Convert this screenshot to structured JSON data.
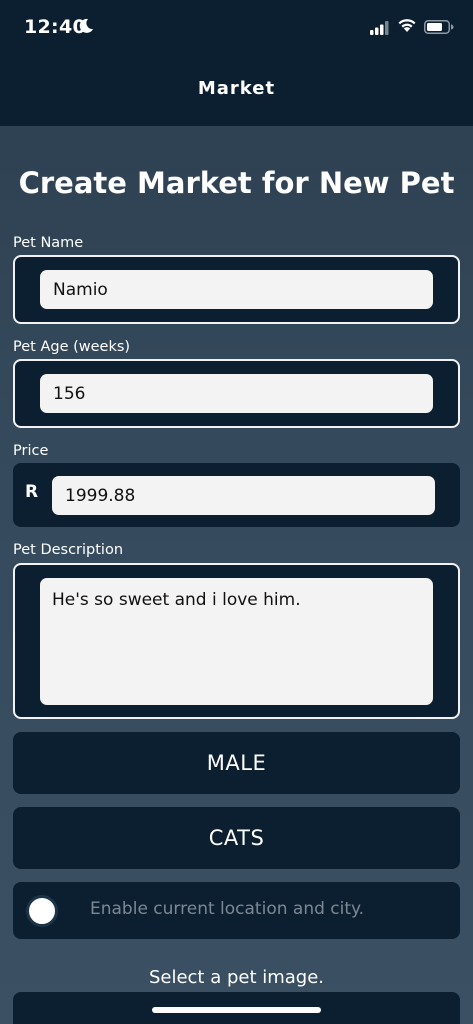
{
  "status_bar": {
    "time": "12:40"
  },
  "nav": {
    "title": "Market"
  },
  "page": {
    "title": "Create Market for New Pet"
  },
  "form": {
    "pet_name": {
      "label": "Pet Name",
      "value": "Namio"
    },
    "pet_age": {
      "label": "Pet Age (weeks)",
      "value": "156"
    },
    "price": {
      "label": "Price",
      "currency": "R",
      "value": "1999.88"
    },
    "description": {
      "label": "Pet Description",
      "value": "He's so sweet and i love him."
    },
    "gender_button": "MALE",
    "category_button": "CATS",
    "location_toggle": {
      "label": "Enable current location and city.",
      "enabled": false
    },
    "image_prompt": "Select a pet image."
  },
  "colors": {
    "header_bg": "#0c1f31",
    "field_bg": "#0c1f31",
    "input_bg": "#f3f3f3",
    "page_bg": "#34495b"
  },
  "icons": [
    "moon-icon",
    "signal-icon",
    "wifi-icon",
    "battery-icon"
  ]
}
